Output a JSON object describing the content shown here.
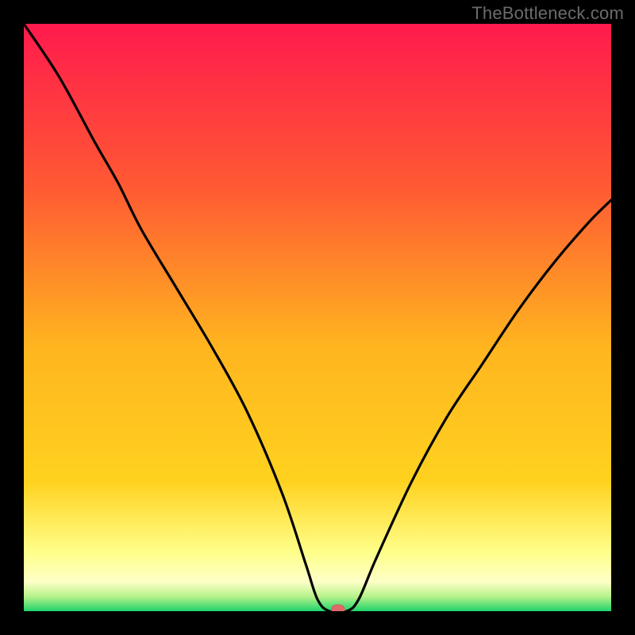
{
  "attribution": "TheBottleneck.com",
  "colors": {
    "page_bg": "#000000",
    "grad_top": "#ff1a4d",
    "grad_mid1": "#ff6a2a",
    "grad_mid2": "#ffd21f",
    "grad_lightband": "#ffff9e",
    "grad_green": "#1fd36b",
    "curve": "#000000",
    "marker_fill": "#e06a6a",
    "marker_stroke": "#d15a5a"
  },
  "chart_data": {
    "type": "line",
    "title": "",
    "xlabel": "",
    "ylabel": "",
    "xlim": [
      0,
      100
    ],
    "ylim": [
      0,
      100
    ],
    "grid": false,
    "legend": false,
    "series": [
      {
        "name": "bottleneck-curve",
        "x": [
          0,
          6,
          12,
          16,
          20,
          26,
          32,
          38,
          44,
          48,
          50,
          52,
          55,
          57,
          60,
          66,
          72,
          78,
          84,
          90,
          96,
          100
        ],
        "y": [
          100,
          91,
          80,
          73,
          65,
          55,
          45,
          34,
          20,
          8,
          2,
          0,
          0,
          2,
          9,
          22,
          33,
          42,
          51,
          59,
          66,
          70
        ]
      }
    ],
    "annotations": [
      {
        "name": "min-marker",
        "x": 53.5,
        "y": 0,
        "shape": "pill"
      }
    ]
  }
}
